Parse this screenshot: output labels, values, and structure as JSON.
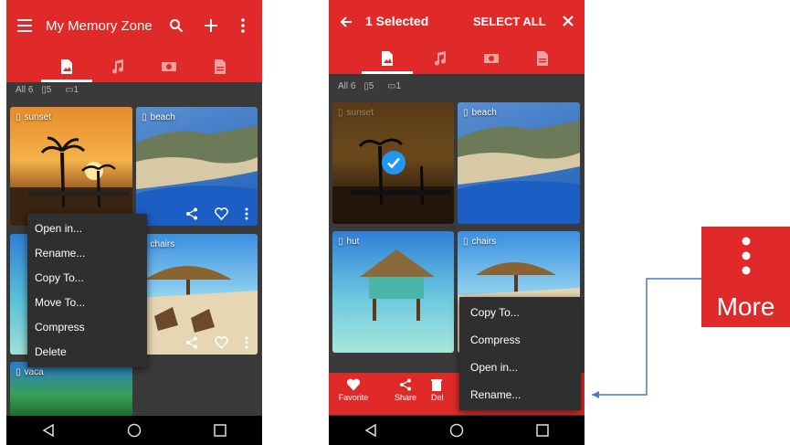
{
  "screen1": {
    "title": "My Memory Zone",
    "counts": {
      "all": "All 6",
      "images": "5",
      "other": "1"
    },
    "cards": [
      {
        "label": "sunset"
      },
      {
        "label": "beach"
      },
      {
        "label": "chairs"
      },
      {
        "label": "vaca"
      }
    ],
    "context_menu": [
      "Open in...",
      "Rename...",
      "Copy To...",
      "Move To...",
      "Compress",
      "Delete"
    ]
  },
  "screen2": {
    "title": "1 Selected",
    "select_all": "SELECT ALL",
    "counts": {
      "all": "All 6",
      "images": "5",
      "other": "1"
    },
    "cards": [
      {
        "label": "sunset"
      },
      {
        "label": "beach"
      },
      {
        "label": "hut"
      },
      {
        "label": "chairs"
      }
    ],
    "more_menu": [
      "Copy To...",
      "Compress",
      "Open in...",
      "Rename..."
    ],
    "bottom_bar": [
      {
        "label": "Favorite"
      },
      {
        "label": "Share"
      },
      {
        "label": "Del"
      }
    ]
  },
  "callout": {
    "label": "More"
  },
  "colors": {
    "accent": "#e02a2a",
    "menu_bg": "#2f2f2f",
    "check": "#2196f3"
  }
}
